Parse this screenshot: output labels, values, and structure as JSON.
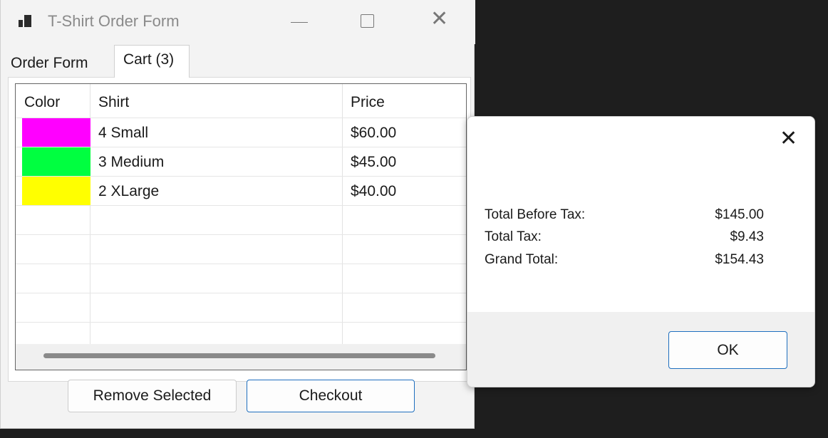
{
  "window": {
    "title": "T-Shirt Order Form",
    "controls": {
      "minimize": "minimize-icon",
      "maximize": "maximize-icon",
      "close": "close-icon"
    }
  },
  "tabs": [
    {
      "label": "Order Form",
      "selected": false
    },
    {
      "label": "Cart (3)",
      "selected": true
    }
  ],
  "cart": {
    "columns": [
      "Color",
      "Shirt",
      "Price"
    ],
    "rows": [
      {
        "color": "#ff00ff",
        "shirt": "4 Small",
        "price": "$60.00"
      },
      {
        "color": "#00ff40",
        "shirt": "3 Medium",
        "price": "$45.00"
      },
      {
        "color": "#ffff00",
        "shirt": "2 XLarge",
        "price": "$40.00"
      }
    ],
    "buttons": {
      "remove": "Remove Selected",
      "checkout": "Checkout"
    }
  },
  "dialog": {
    "close_icon": "close-icon",
    "summary": [
      {
        "label": "Total Before Tax:",
        "value": "$145.00"
      },
      {
        "label": "Total Tax:",
        "value": "$9.43"
      },
      {
        "label": "Grand Total:",
        "value": "$154.43"
      }
    ],
    "ok_label": "OK"
  },
  "colors": {
    "accent": "#1f6fbf",
    "desktop_background": "#1e1e1e"
  }
}
